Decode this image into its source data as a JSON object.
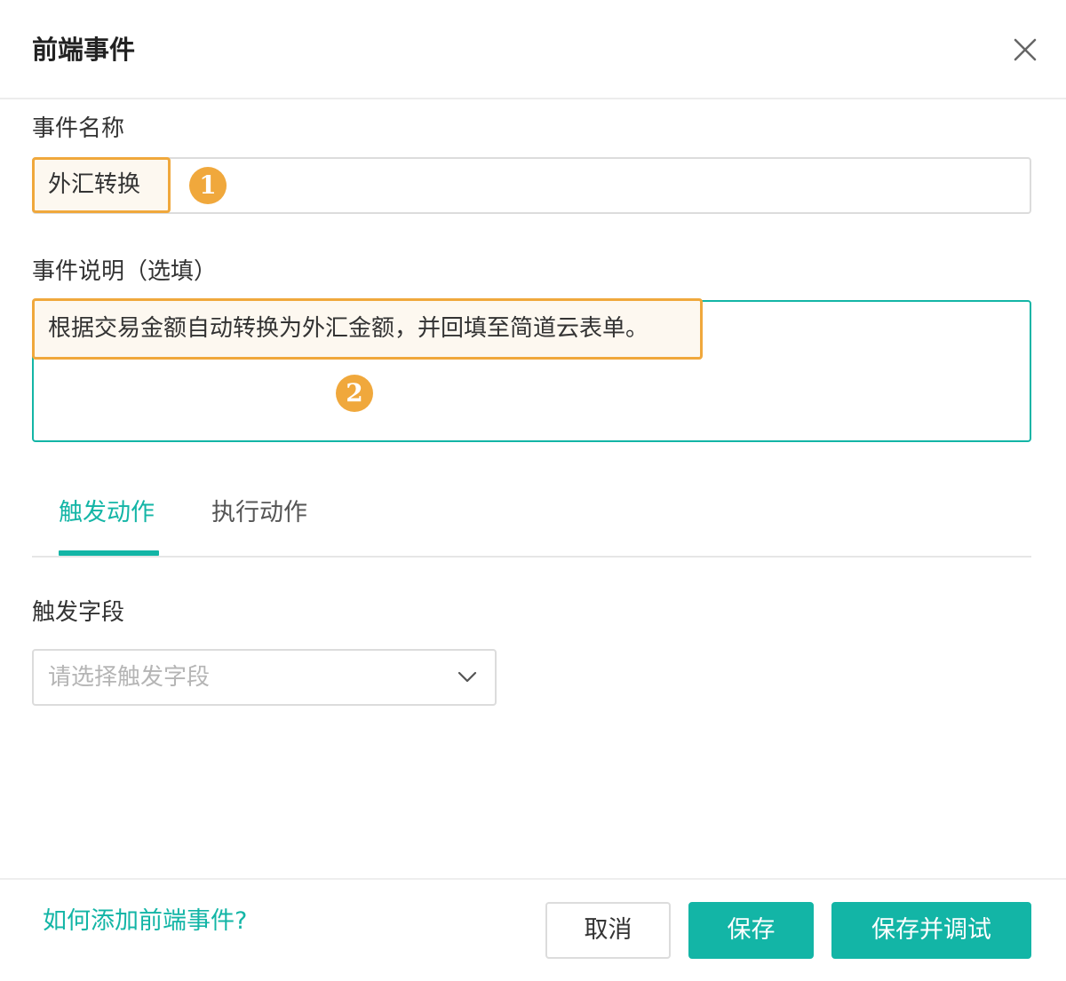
{
  "dialog": {
    "title": "前端事件",
    "close_icon": "close-icon"
  },
  "form": {
    "name_label": "事件名称",
    "name_value": "外汇转换",
    "desc_label": "事件说明（选填）",
    "desc_value": "根据交易金额自动转换为外汇金额，并回填至简道云表单。"
  },
  "annotations": {
    "badge_1": "1",
    "badge_2": "2",
    "color": "#f0a83c"
  },
  "tabs": [
    {
      "label": "触发动作",
      "active": true
    },
    {
      "label": "执行动作",
      "active": false
    }
  ],
  "trigger": {
    "field_label": "触发字段",
    "select_placeholder": "请选择触发字段",
    "arrow_icon": "chevron-down-icon"
  },
  "footer": {
    "help_link": "如何添加前端事件?",
    "cancel_label": "取消",
    "save_label": "保存",
    "save_debug_label": "保存并调试"
  },
  "colors": {
    "accent": "#13b5a6",
    "highlight": "#f0a83c"
  }
}
